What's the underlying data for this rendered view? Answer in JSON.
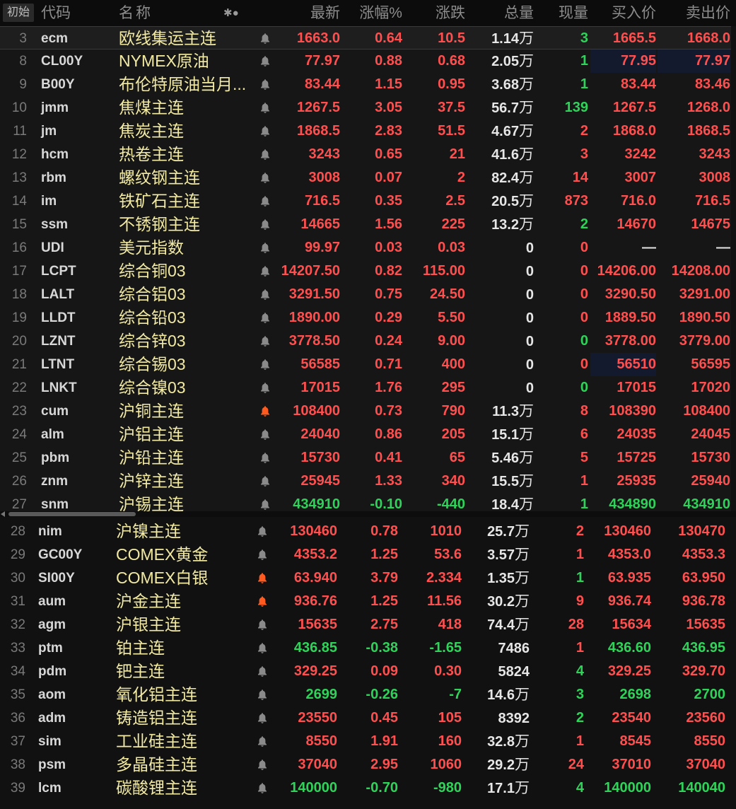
{
  "header": {
    "mode_button": "初始",
    "columns": {
      "code": "代码",
      "name": "称",
      "name_prefix": "名",
      "settings": "✱●",
      "last": "最新",
      "change_pct": "涨幅%",
      "change": "涨跌",
      "volume": "总量",
      "current_volume": "现量",
      "bid": "买入价",
      "ask": "卖出价"
    }
  },
  "colors": {
    "up": "#ff4f4f",
    "down": "#2fd35a",
    "name": "#f2eaa2",
    "bell_inactive": "#8a8a8a",
    "bell_active": "#ff5a1f"
  },
  "top_rows": [
    {
      "idx": "3",
      "code": "ecm",
      "name": "欧线集运主连",
      "bell": "inactive",
      "last": "1663.0",
      "pct": "0.64",
      "chg": "10.5",
      "vol": "1.14",
      "vol_unit": "万",
      "cur": "3",
      "cur_dir": "dn",
      "bid": "1665.5",
      "ask": "1668.0",
      "dir": "up",
      "selected": true
    },
    {
      "idx": "8",
      "code": "CL00Y",
      "name": "NYMEX原油",
      "bell": "inactive",
      "last": "77.97",
      "pct": "0.88",
      "chg": "0.68",
      "vol": "2.05",
      "vol_unit": "万",
      "cur": "1",
      "cur_dir": "dn",
      "bid": "77.95",
      "ask": "77.97",
      "dir": "up",
      "hl": true
    },
    {
      "idx": "9",
      "code": "B00Y",
      "name": "布伦特原油当月...",
      "bell": "inactive",
      "last": "83.44",
      "pct": "1.15",
      "chg": "0.95",
      "vol": "3.68",
      "vol_unit": "万",
      "cur": "1",
      "cur_dir": "dn",
      "bid": "83.44",
      "ask": "83.46",
      "dir": "up"
    },
    {
      "idx": "10",
      "code": "jmm",
      "name": "焦煤主连",
      "bell": "inactive",
      "last": "1267.5",
      "pct": "3.05",
      "chg": "37.5",
      "vol": "56.7",
      "vol_unit": "万",
      "cur": "139",
      "cur_dir": "dn",
      "bid": "1267.5",
      "ask": "1268.0",
      "dir": "up"
    },
    {
      "idx": "11",
      "code": "jm",
      "name": "焦炭主连",
      "bell": "inactive",
      "last": "1868.5",
      "pct": "2.83",
      "chg": "51.5",
      "vol": "4.67",
      "vol_unit": "万",
      "cur": "2",
      "cur_dir": "up",
      "bid": "1868.0",
      "ask": "1868.5",
      "dir": "up"
    },
    {
      "idx": "12",
      "code": "hcm",
      "name": "热卷主连",
      "bell": "inactive",
      "last": "3243",
      "pct": "0.65",
      "chg": "21",
      "vol": "41.6",
      "vol_unit": "万",
      "cur": "3",
      "cur_dir": "up",
      "bid": "3242",
      "ask": "3243",
      "dir": "up"
    },
    {
      "idx": "13",
      "code": "rbm",
      "name": "螺纹钢主连",
      "bell": "inactive",
      "last": "3008",
      "pct": "0.07",
      "chg": "2",
      "vol": "82.4",
      "vol_unit": "万",
      "cur": "14",
      "cur_dir": "up",
      "bid": "3007",
      "ask": "3008",
      "dir": "up"
    },
    {
      "idx": "14",
      "code": "im",
      "name": "铁矿石主连",
      "bell": "inactive",
      "last": "716.5",
      "pct": "0.35",
      "chg": "2.5",
      "vol": "20.5",
      "vol_unit": "万",
      "cur": "873",
      "cur_dir": "up",
      "bid": "716.0",
      "ask": "716.5",
      "dir": "up"
    },
    {
      "idx": "15",
      "code": "ssm",
      "name": "不锈钢主连",
      "bell": "inactive",
      "last": "14665",
      "pct": "1.56",
      "chg": "225",
      "vol": "13.2",
      "vol_unit": "万",
      "cur": "2",
      "cur_dir": "dn",
      "bid": "14670",
      "ask": "14675",
      "dir": "up"
    },
    {
      "idx": "16",
      "code": "UDI",
      "name": "美元指数",
      "bell": "inactive",
      "last": "99.97",
      "pct": "0.03",
      "chg": "0.03",
      "vol": "0",
      "vol_unit": "",
      "cur": "0",
      "cur_dir": "up",
      "bid": "—",
      "ask": "—",
      "dir": "up",
      "bidask_neu": true
    },
    {
      "idx": "17",
      "code": "LCPT",
      "name": "综合铜03",
      "bell": "inactive",
      "last": "14207.50",
      "pct": "0.82",
      "chg": "115.00",
      "vol": "0",
      "vol_unit": "",
      "cur": "0",
      "cur_dir": "up",
      "bid": "14206.00",
      "ask": "14208.00",
      "dir": "up"
    },
    {
      "idx": "18",
      "code": "LALT",
      "name": "综合铝03",
      "bell": "inactive",
      "last": "3291.50",
      "pct": "0.75",
      "chg": "24.50",
      "vol": "0",
      "vol_unit": "",
      "cur": "0",
      "cur_dir": "up",
      "bid": "3290.50",
      "ask": "3291.00",
      "dir": "up"
    },
    {
      "idx": "19",
      "code": "LLDT",
      "name": "综合铅03",
      "bell": "inactive",
      "last": "1890.00",
      "pct": "0.29",
      "chg": "5.50",
      "vol": "0",
      "vol_unit": "",
      "cur": "0",
      "cur_dir": "up",
      "bid": "1889.50",
      "ask": "1890.50",
      "dir": "up"
    },
    {
      "idx": "20",
      "code": "LZNT",
      "name": "综合锌03",
      "bell": "inactive",
      "last": "3778.50",
      "pct": "0.24",
      "chg": "9.00",
      "vol": "0",
      "vol_unit": "",
      "cur": "0",
      "cur_dir": "dn",
      "bid": "3778.00",
      "ask": "3779.00",
      "dir": "up"
    },
    {
      "idx": "21",
      "code": "LTNT",
      "name": "综合锡03",
      "bell": "inactive",
      "last": "56585",
      "pct": "0.71",
      "chg": "400",
      "vol": "0",
      "vol_unit": "",
      "cur": "0",
      "cur_dir": "up",
      "bid": "56510",
      "ask": "56595",
      "dir": "up",
      "hl_bid": true
    },
    {
      "idx": "22",
      "code": "LNKT",
      "name": "综合镍03",
      "bell": "inactive",
      "last": "17015",
      "pct": "1.76",
      "chg": "295",
      "vol": "0",
      "vol_unit": "",
      "cur": "0",
      "cur_dir": "dn",
      "bid": "17015",
      "ask": "17020",
      "dir": "up"
    },
    {
      "idx": "23",
      "code": "cum",
      "name": "沪铜主连",
      "bell": "active",
      "last": "108400",
      "pct": "0.73",
      "chg": "790",
      "vol": "11.3",
      "vol_unit": "万",
      "cur": "8",
      "cur_dir": "up",
      "bid": "108390",
      "ask": "108400",
      "dir": "up"
    },
    {
      "idx": "24",
      "code": "alm",
      "name": "沪铝主连",
      "bell": "inactive",
      "last": "24040",
      "pct": "0.86",
      "chg": "205",
      "vol": "15.1",
      "vol_unit": "万",
      "cur": "6",
      "cur_dir": "up",
      "bid": "24035",
      "ask": "24045",
      "dir": "up"
    },
    {
      "idx": "25",
      "code": "pbm",
      "name": "沪铅主连",
      "bell": "inactive",
      "last": "15730",
      "pct": "0.41",
      "chg": "65",
      "vol": "5.46",
      "vol_unit": "万",
      "cur": "5",
      "cur_dir": "up",
      "bid": "15725",
      "ask": "15730",
      "dir": "up"
    },
    {
      "idx": "26",
      "code": "znm",
      "name": "沪锌主连",
      "bell": "inactive",
      "last": "25945",
      "pct": "1.33",
      "chg": "340",
      "vol": "15.5",
      "vol_unit": "万",
      "cur": "1",
      "cur_dir": "up",
      "bid": "25935",
      "ask": "25940",
      "dir": "up"
    },
    {
      "idx": "27",
      "code": "snm",
      "name": "沪锡主连",
      "bell": "inactive",
      "last": "434910",
      "pct": "-0.10",
      "chg": "-440",
      "vol": "18.4",
      "vol_unit": "万",
      "cur": "1",
      "cur_dir": "dn",
      "bid": "434890",
      "ask": "434910",
      "dir": "dn"
    }
  ],
  "bottom_rows": [
    {
      "idx": "28",
      "code": "nim",
      "name": "沪镍主连",
      "bell": "inactive",
      "last": "130460",
      "pct": "0.78",
      "chg": "1010",
      "vol": "25.7",
      "vol_unit": "万",
      "cur": "2",
      "cur_dir": "up",
      "bid": "130460",
      "ask": "130470",
      "dir": "up"
    },
    {
      "idx": "29",
      "code": "GC00Y",
      "name": "COMEX黄金",
      "bell": "inactive",
      "last": "4353.2",
      "pct": "1.25",
      "chg": "53.6",
      "vol": "3.57",
      "vol_unit": "万",
      "cur": "1",
      "cur_dir": "up",
      "bid": "4353.0",
      "ask": "4353.3",
      "dir": "up"
    },
    {
      "idx": "30",
      "code": "SI00Y",
      "name": "COMEX白银",
      "bell": "active",
      "last": "63.940",
      "pct": "3.79",
      "chg": "2.334",
      "vol": "1.35",
      "vol_unit": "万",
      "cur": "1",
      "cur_dir": "dn",
      "bid": "63.935",
      "ask": "63.950",
      "dir": "up"
    },
    {
      "idx": "31",
      "code": "aum",
      "name": "沪金主连",
      "bell": "active",
      "last": "936.76",
      "pct": "1.25",
      "chg": "11.56",
      "vol": "30.2",
      "vol_unit": "万",
      "cur": "9",
      "cur_dir": "up",
      "bid": "936.74",
      "ask": "936.78",
      "dir": "up"
    },
    {
      "idx": "32",
      "code": "agm",
      "name": "沪银主连",
      "bell": "inactive",
      "last": "15635",
      "pct": "2.75",
      "chg": "418",
      "vol": "74.4",
      "vol_unit": "万",
      "cur": "28",
      "cur_dir": "up",
      "bid": "15634",
      "ask": "15635",
      "dir": "up"
    },
    {
      "idx": "33",
      "code": "ptm",
      "name": "铂主连",
      "bell": "inactive",
      "last": "436.85",
      "pct": "-0.38",
      "chg": "-1.65",
      "vol": "7486",
      "vol_unit": "",
      "cur": "1",
      "cur_dir": "up",
      "bid": "436.60",
      "ask": "436.95",
      "dir": "dn"
    },
    {
      "idx": "34",
      "code": "pdm",
      "name": "钯主连",
      "bell": "inactive",
      "last": "329.25",
      "pct": "0.09",
      "chg": "0.30",
      "vol": "5824",
      "vol_unit": "",
      "cur": "4",
      "cur_dir": "dn",
      "bid": "329.25",
      "ask": "329.70",
      "dir": "up"
    },
    {
      "idx": "35",
      "code": "aom",
      "name": "氧化铝主连",
      "bell": "inactive",
      "last": "2699",
      "pct": "-0.26",
      "chg": "-7",
      "vol": "14.6",
      "vol_unit": "万",
      "cur": "3",
      "cur_dir": "dn",
      "bid": "2698",
      "ask": "2700",
      "dir": "dn"
    },
    {
      "idx": "36",
      "code": "adm",
      "name": "铸造铝主连",
      "bell": "inactive",
      "last": "23550",
      "pct": "0.45",
      "chg": "105",
      "vol": "8392",
      "vol_unit": "",
      "cur": "2",
      "cur_dir": "dn",
      "bid": "23540",
      "ask": "23560",
      "dir": "up"
    },
    {
      "idx": "37",
      "code": "sim",
      "name": "工业硅主连",
      "bell": "inactive",
      "last": "8550",
      "pct": "1.91",
      "chg": "160",
      "vol": "32.8",
      "vol_unit": "万",
      "cur": "1",
      "cur_dir": "up",
      "bid": "8545",
      "ask": "8550",
      "dir": "up"
    },
    {
      "idx": "38",
      "code": "psm",
      "name": "多晶硅主连",
      "bell": "inactive",
      "last": "37040",
      "pct": "2.95",
      "chg": "1060",
      "vol": "29.2",
      "vol_unit": "万",
      "cur": "24",
      "cur_dir": "up",
      "bid": "37010",
      "ask": "37040",
      "dir": "up"
    },
    {
      "idx": "39",
      "code": "lcm",
      "name": "碳酸锂主连",
      "bell": "inactive",
      "last": "140000",
      "pct": "-0.70",
      "chg": "-980",
      "vol": "17.1",
      "vol_unit": "万",
      "cur": "4",
      "cur_dir": "dn",
      "bid": "140000",
      "ask": "140040",
      "dir": "dn"
    }
  ]
}
